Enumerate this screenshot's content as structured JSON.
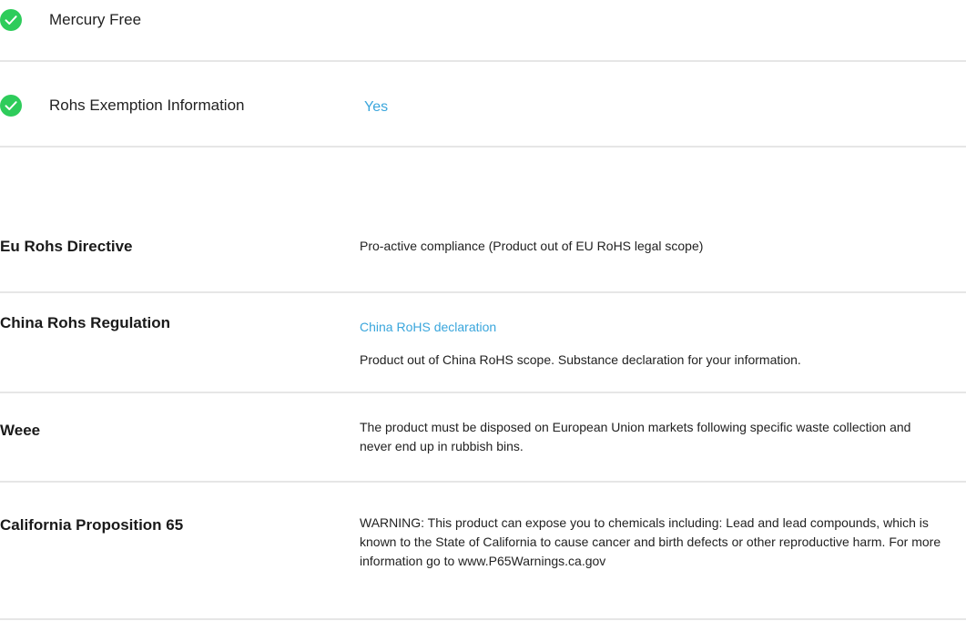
{
  "checks": [
    {
      "icon": "check-circle-icon",
      "label": "Mercury Free",
      "value": ""
    },
    {
      "icon": "check-circle-icon",
      "label": "Rohs Exemption Information",
      "value": "Yes"
    }
  ],
  "specs": {
    "eu_rohs": {
      "label": "Eu Rohs Directive",
      "value": "Pro-active compliance (Product out of EU RoHS legal scope)"
    },
    "china_rohs": {
      "label": "China Rohs Regulation",
      "link": "China RoHS declaration",
      "value": "Product out of China RoHS scope. Substance declaration for your information."
    },
    "weee": {
      "label": "Weee",
      "value": "The product must be disposed on European Union markets following specific waste collection and never end up in rubbish bins."
    },
    "prop65": {
      "label": "California Proposition 65",
      "value": "WARNING: This product can expose you to chemicals including: Lead and lead compounds, which is known to the State of California to cause cancer and birth defects or other reproductive harm. For more information go to www.P65Warnings.ca.gov"
    }
  },
  "colors": {
    "check_green": "#2ecc5b",
    "link_blue": "#3aa6dc",
    "divider": "#e6e6e6"
  }
}
